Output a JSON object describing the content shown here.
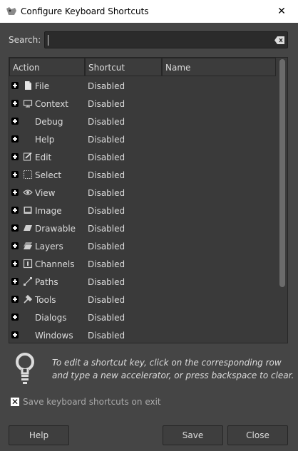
{
  "window": {
    "title": "Configure Keyboard Shortcuts",
    "close_glyph": "✕"
  },
  "search": {
    "label": "Search:",
    "value": "",
    "clear_icon": "backspace-icon"
  },
  "tree": {
    "columns": [
      "Action",
      "Shortcut",
      "Name"
    ],
    "rows": [
      {
        "label": "File",
        "shortcut": "Disabled",
        "icon": "file-icon"
      },
      {
        "label": "Context",
        "shortcut": "Disabled",
        "icon": "context-icon"
      },
      {
        "label": "Debug",
        "shortcut": "Disabled",
        "icon": ""
      },
      {
        "label": "Help",
        "shortcut": "Disabled",
        "icon": ""
      },
      {
        "label": "Edit",
        "shortcut": "Disabled",
        "icon": "edit-icon"
      },
      {
        "label": "Select",
        "shortcut": "Disabled",
        "icon": "select-icon"
      },
      {
        "label": "View",
        "shortcut": "Disabled",
        "icon": "eye-icon"
      },
      {
        "label": "Image",
        "shortcut": "Disabled",
        "icon": "image-icon"
      },
      {
        "label": "Drawable",
        "shortcut": "Disabled",
        "icon": "drawable-icon"
      },
      {
        "label": "Layers",
        "shortcut": "Disabled",
        "icon": "layers-icon"
      },
      {
        "label": "Channels",
        "shortcut": "Disabled",
        "icon": "channels-icon"
      },
      {
        "label": "Paths",
        "shortcut": "Disabled",
        "icon": "paths-icon"
      },
      {
        "label": "Tools",
        "shortcut": "Disabled",
        "icon": "tools-icon"
      },
      {
        "label": "Dialogs",
        "shortcut": "Disabled",
        "icon": ""
      },
      {
        "label": "Windows",
        "shortcut": "Disabled",
        "icon": ""
      }
    ]
  },
  "hint": {
    "text": "To edit a shortcut key, click on the corresponding row and type a new accelerator, or press backspace to clear.",
    "icon": "lightbulb-icon"
  },
  "options": {
    "save_on_exit_label": "Save keyboard shortcuts on exit",
    "save_on_exit_checked": true
  },
  "buttons": {
    "help": "Help",
    "save": "Save",
    "close": "Close"
  }
}
